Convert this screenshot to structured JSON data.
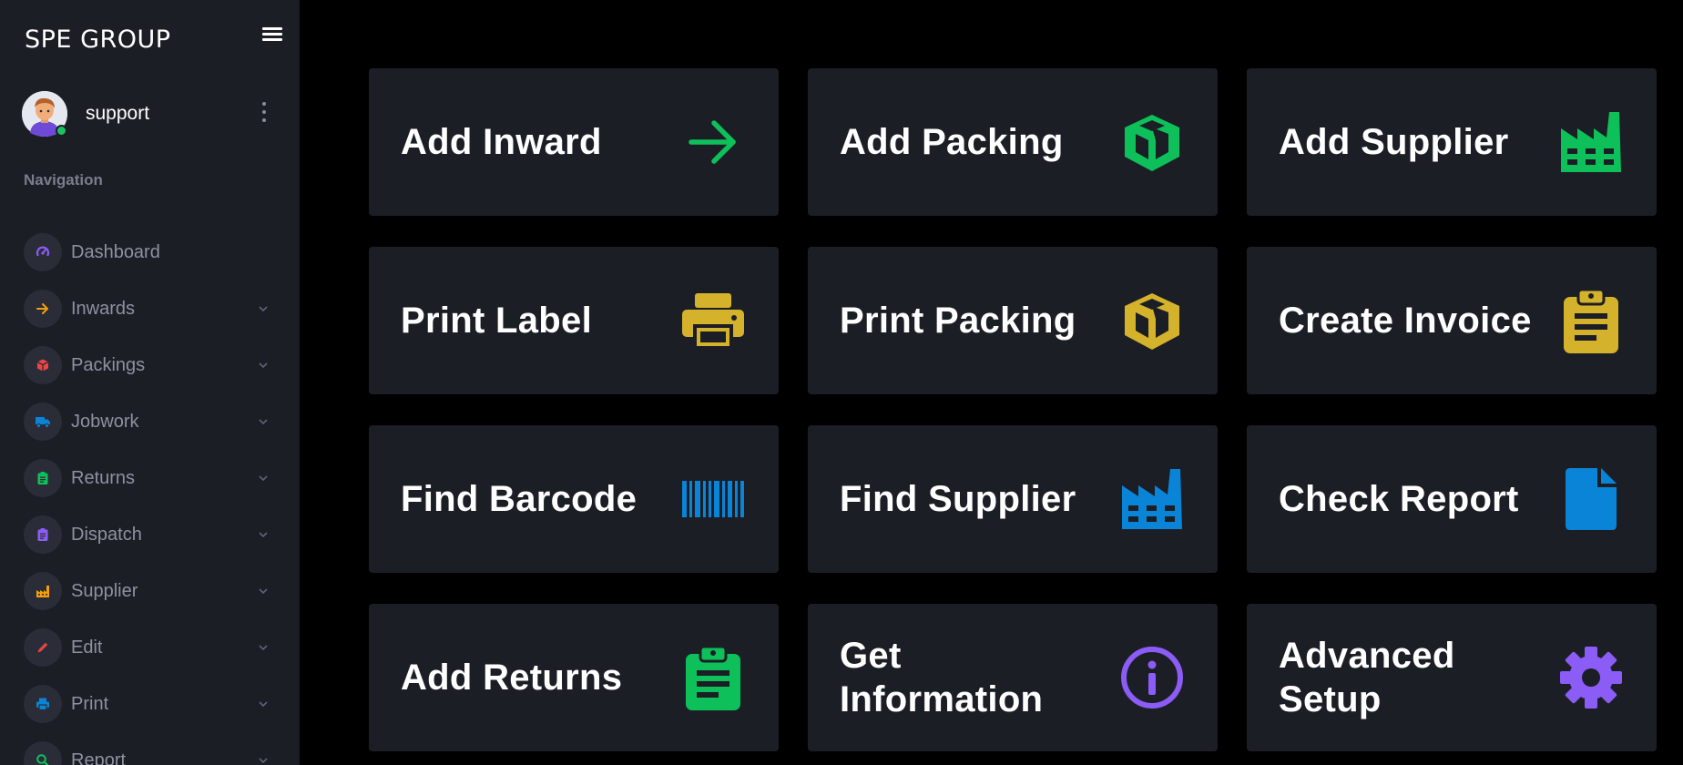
{
  "sidebar": {
    "brand": "SPE GROUP",
    "user": {
      "name": "support",
      "status_color": "#1ec15f"
    },
    "nav_heading": "Navigation",
    "items": [
      {
        "label": "Dashboard",
        "icon": "speedometer-icon",
        "color": "#8b5cf6",
        "has_children": false
      },
      {
        "label": "Inwards",
        "icon": "arrow-right-icon",
        "color": "#f59e0b",
        "has_children": true
      },
      {
        "label": "Packings",
        "icon": "box-icon",
        "color": "#ef4444",
        "has_children": true
      },
      {
        "label": "Jobwork",
        "icon": "truck-icon",
        "color": "#0a84d6",
        "has_children": true
      },
      {
        "label": "Returns",
        "icon": "clipboard-icon",
        "color": "#0ec05a",
        "has_children": true
      },
      {
        "label": "Dispatch",
        "icon": "clipboard-icon",
        "color": "#8b5cf6",
        "has_children": true
      },
      {
        "label": "Supplier",
        "icon": "factory-icon",
        "color": "#f59e0b",
        "has_children": true
      },
      {
        "label": "Edit",
        "icon": "pencil-icon",
        "color": "#ef4444",
        "has_children": true
      },
      {
        "label": "Print",
        "icon": "printer-icon",
        "color": "#0a84d6",
        "has_children": true
      },
      {
        "label": "Report",
        "icon": "search-icon",
        "color": "#0ec05a",
        "has_children": true
      }
    ]
  },
  "tiles": [
    {
      "label": "Add Inward",
      "icon": "arrow-right-icon",
      "color": "#0ec05a"
    },
    {
      "label": "Add Packing",
      "icon": "box-icon",
      "color": "#0ec05a"
    },
    {
      "label": "Add Supplier",
      "icon": "factory-icon",
      "color": "#0ec05a"
    },
    {
      "label": "Print Label",
      "icon": "printer-icon",
      "color": "#d4b22b"
    },
    {
      "label": "Print Packing",
      "icon": "box-icon",
      "color": "#d4b22b"
    },
    {
      "label": "Create Invoice",
      "icon": "clipboard-icon",
      "color": "#d4b22b"
    },
    {
      "label": "Find Barcode",
      "icon": "barcode-icon",
      "color": "#0a84d6"
    },
    {
      "label": "Find Supplier",
      "icon": "factory-icon",
      "color": "#0a84d6"
    },
    {
      "label": "Check Report",
      "icon": "file-icon",
      "color": "#0a84d6"
    },
    {
      "label": "Add Returns",
      "icon": "clipboard-icon",
      "color": "#0ec05a"
    },
    {
      "label": "Get Information",
      "icon": "info-icon",
      "color": "#8b5cf6"
    },
    {
      "label": "Advanced Setup",
      "icon": "gear-icon",
      "color": "#8b5cf6"
    }
  ]
}
